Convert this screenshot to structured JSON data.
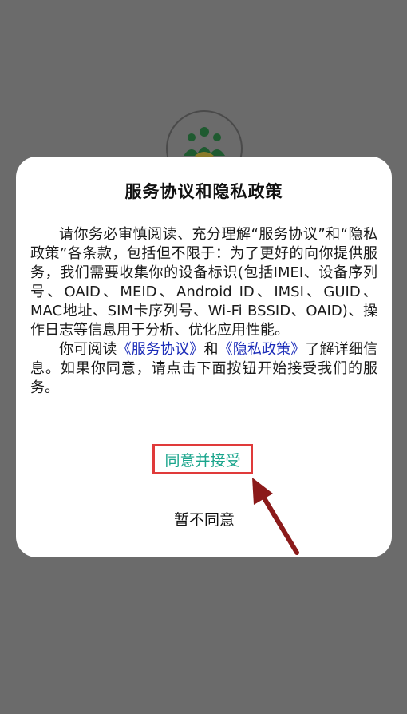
{
  "dialog": {
    "title": "服务协议和隐私政策",
    "para1": "请你务必审慎阅读、充分理解“服务协议”和“隐私政策”各条款，包括但不限于：为了更好的向你提供服务，我们需要收集你的设备标识(包括IMEI、设备序列号、OAID、MEID、Android ID、IMSI、GUID、MAC地址、SIM卡序列号、Wi-Fi BSSID、OAID)、操作日志等信息用于分析、优化应用性能。",
    "para2_prefix": "你可阅读",
    "service_link": "《服务协议》",
    "para2_and": "和",
    "privacy_link": "《隐私政策》",
    "para2_suffix": "了解详细信息。如果你同意，请点击下面按钮开始接受我们的服务。",
    "agree_label": "同意并接受",
    "decline_label": "暂不同意"
  },
  "colors": {
    "overlay": "#6b6b6b",
    "link": "#1a2bb8",
    "agree_text": "#1aa58c",
    "highlight_border": "#e03a3a",
    "arrow": "#8b1a1a",
    "logo_green": "#1f7a3a",
    "logo_gold": "#c9a227"
  },
  "icons": {
    "logo": "people-logo-icon",
    "annotation": "arrow-annotation-icon"
  }
}
